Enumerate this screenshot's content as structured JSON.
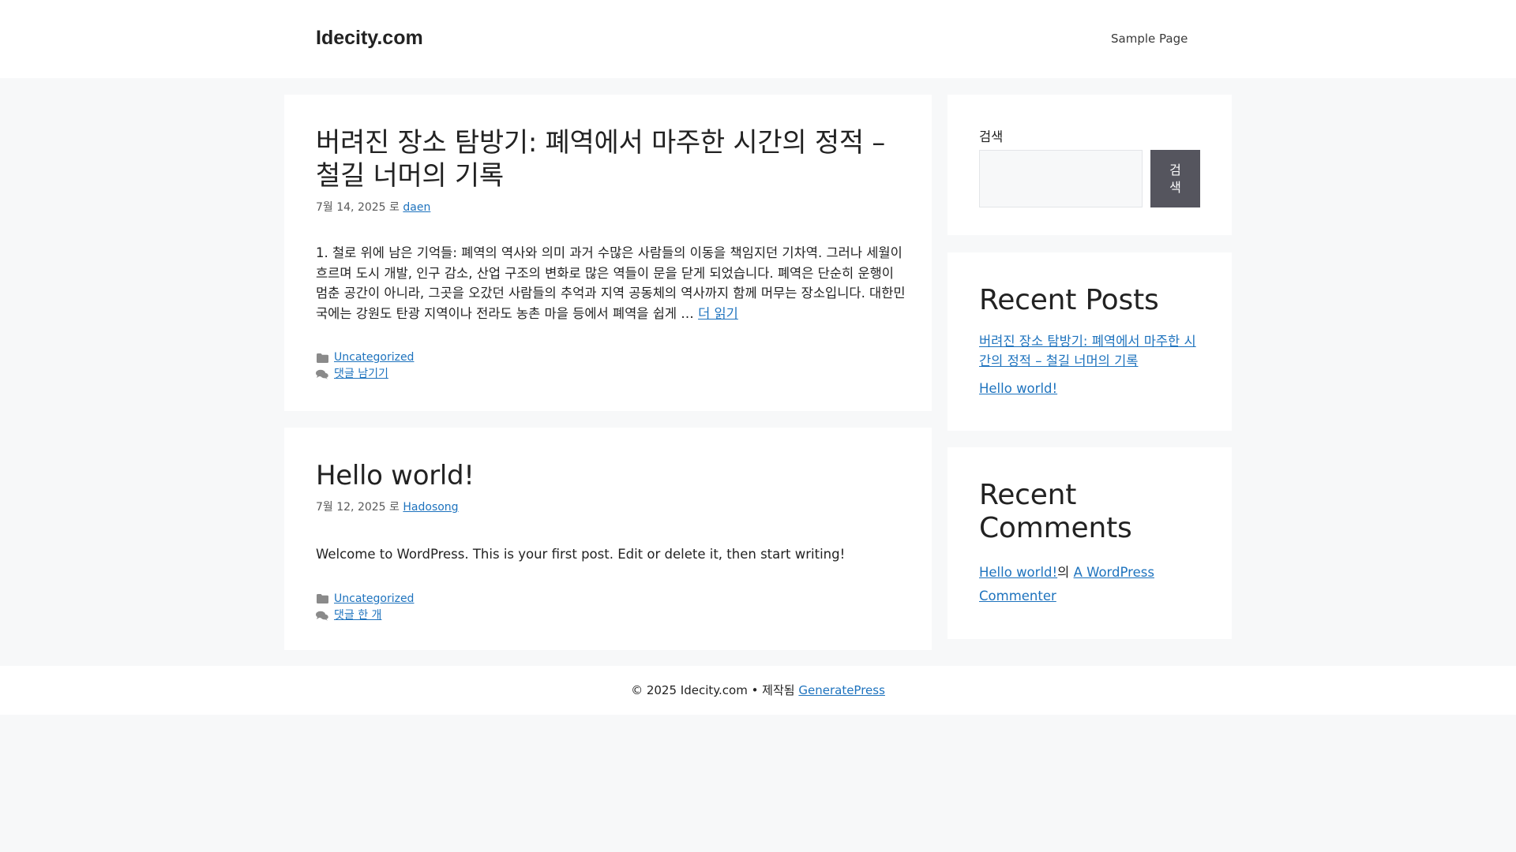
{
  "site": {
    "title": "Idecity.com"
  },
  "nav": {
    "items": [
      {
        "label": "Sample Page"
      }
    ]
  },
  "posts": [
    {
      "title": "버려진 장소 탐방기: 폐역에서 마주한 시간의 정적 – 철길 너머의 기록",
      "date": "7월 14, 2025",
      "by": "로",
      "author": "daen",
      "excerpt": "1. 철로 위에 남은 기억들: 폐역의 역사와 의미 과거 수많은 사람들의 이동을 책임지던 기차역. 그러나 세월이 흐르며 도시 개발, 인구 감소, 산업 구조의 변화로 많은 역들이 문을 닫게 되었습니다. 폐역은 단순히 운행이 멈춘 공간이 아니라, 그곳을 오갔던 사람들의 추억과 지역 공동체의 역사까지 함께 머무는 장소입니다. 대한민국에는 강원도 탄광 지역이나 전라도 농촌 마을 등에서 폐역을 쉽게 …",
      "read_more": "더 읽기",
      "category": "Uncategorized",
      "comments": "댓글 남기기"
    },
    {
      "title": "Hello world!",
      "date": "7월 12, 2025",
      "by": "로",
      "author": "Hadosong",
      "excerpt": "Welcome to WordPress. This is your first post. Edit or delete it, then start writing!",
      "category": "Uncategorized",
      "comments": "댓글 한 개"
    }
  ],
  "sidebar": {
    "search": {
      "label": "검색",
      "button": "검색",
      "value": ""
    },
    "recent_posts": {
      "title": "Recent Posts",
      "items": [
        {
          "label": "버려진 장소 탐방기: 폐역에서 마주한 시간의 정적 – 철길 너머의 기록"
        },
        {
          "label": "Hello world!"
        }
      ]
    },
    "recent_comments": {
      "title": "Recent Comments",
      "items": [
        {
          "post": "Hello world!",
          "joiner": "의",
          "author": "A WordPress Commenter"
        }
      ]
    }
  },
  "footer": {
    "copyright": "© 2025 Idecity.com • 제작됨",
    "link": "GeneratePress"
  },
  "colors": {
    "link": "#1e73be",
    "button": "#55555e",
    "background": "#f7f8f9"
  },
  "icons": {
    "category": "folder-icon",
    "comments": "comments-icon"
  }
}
